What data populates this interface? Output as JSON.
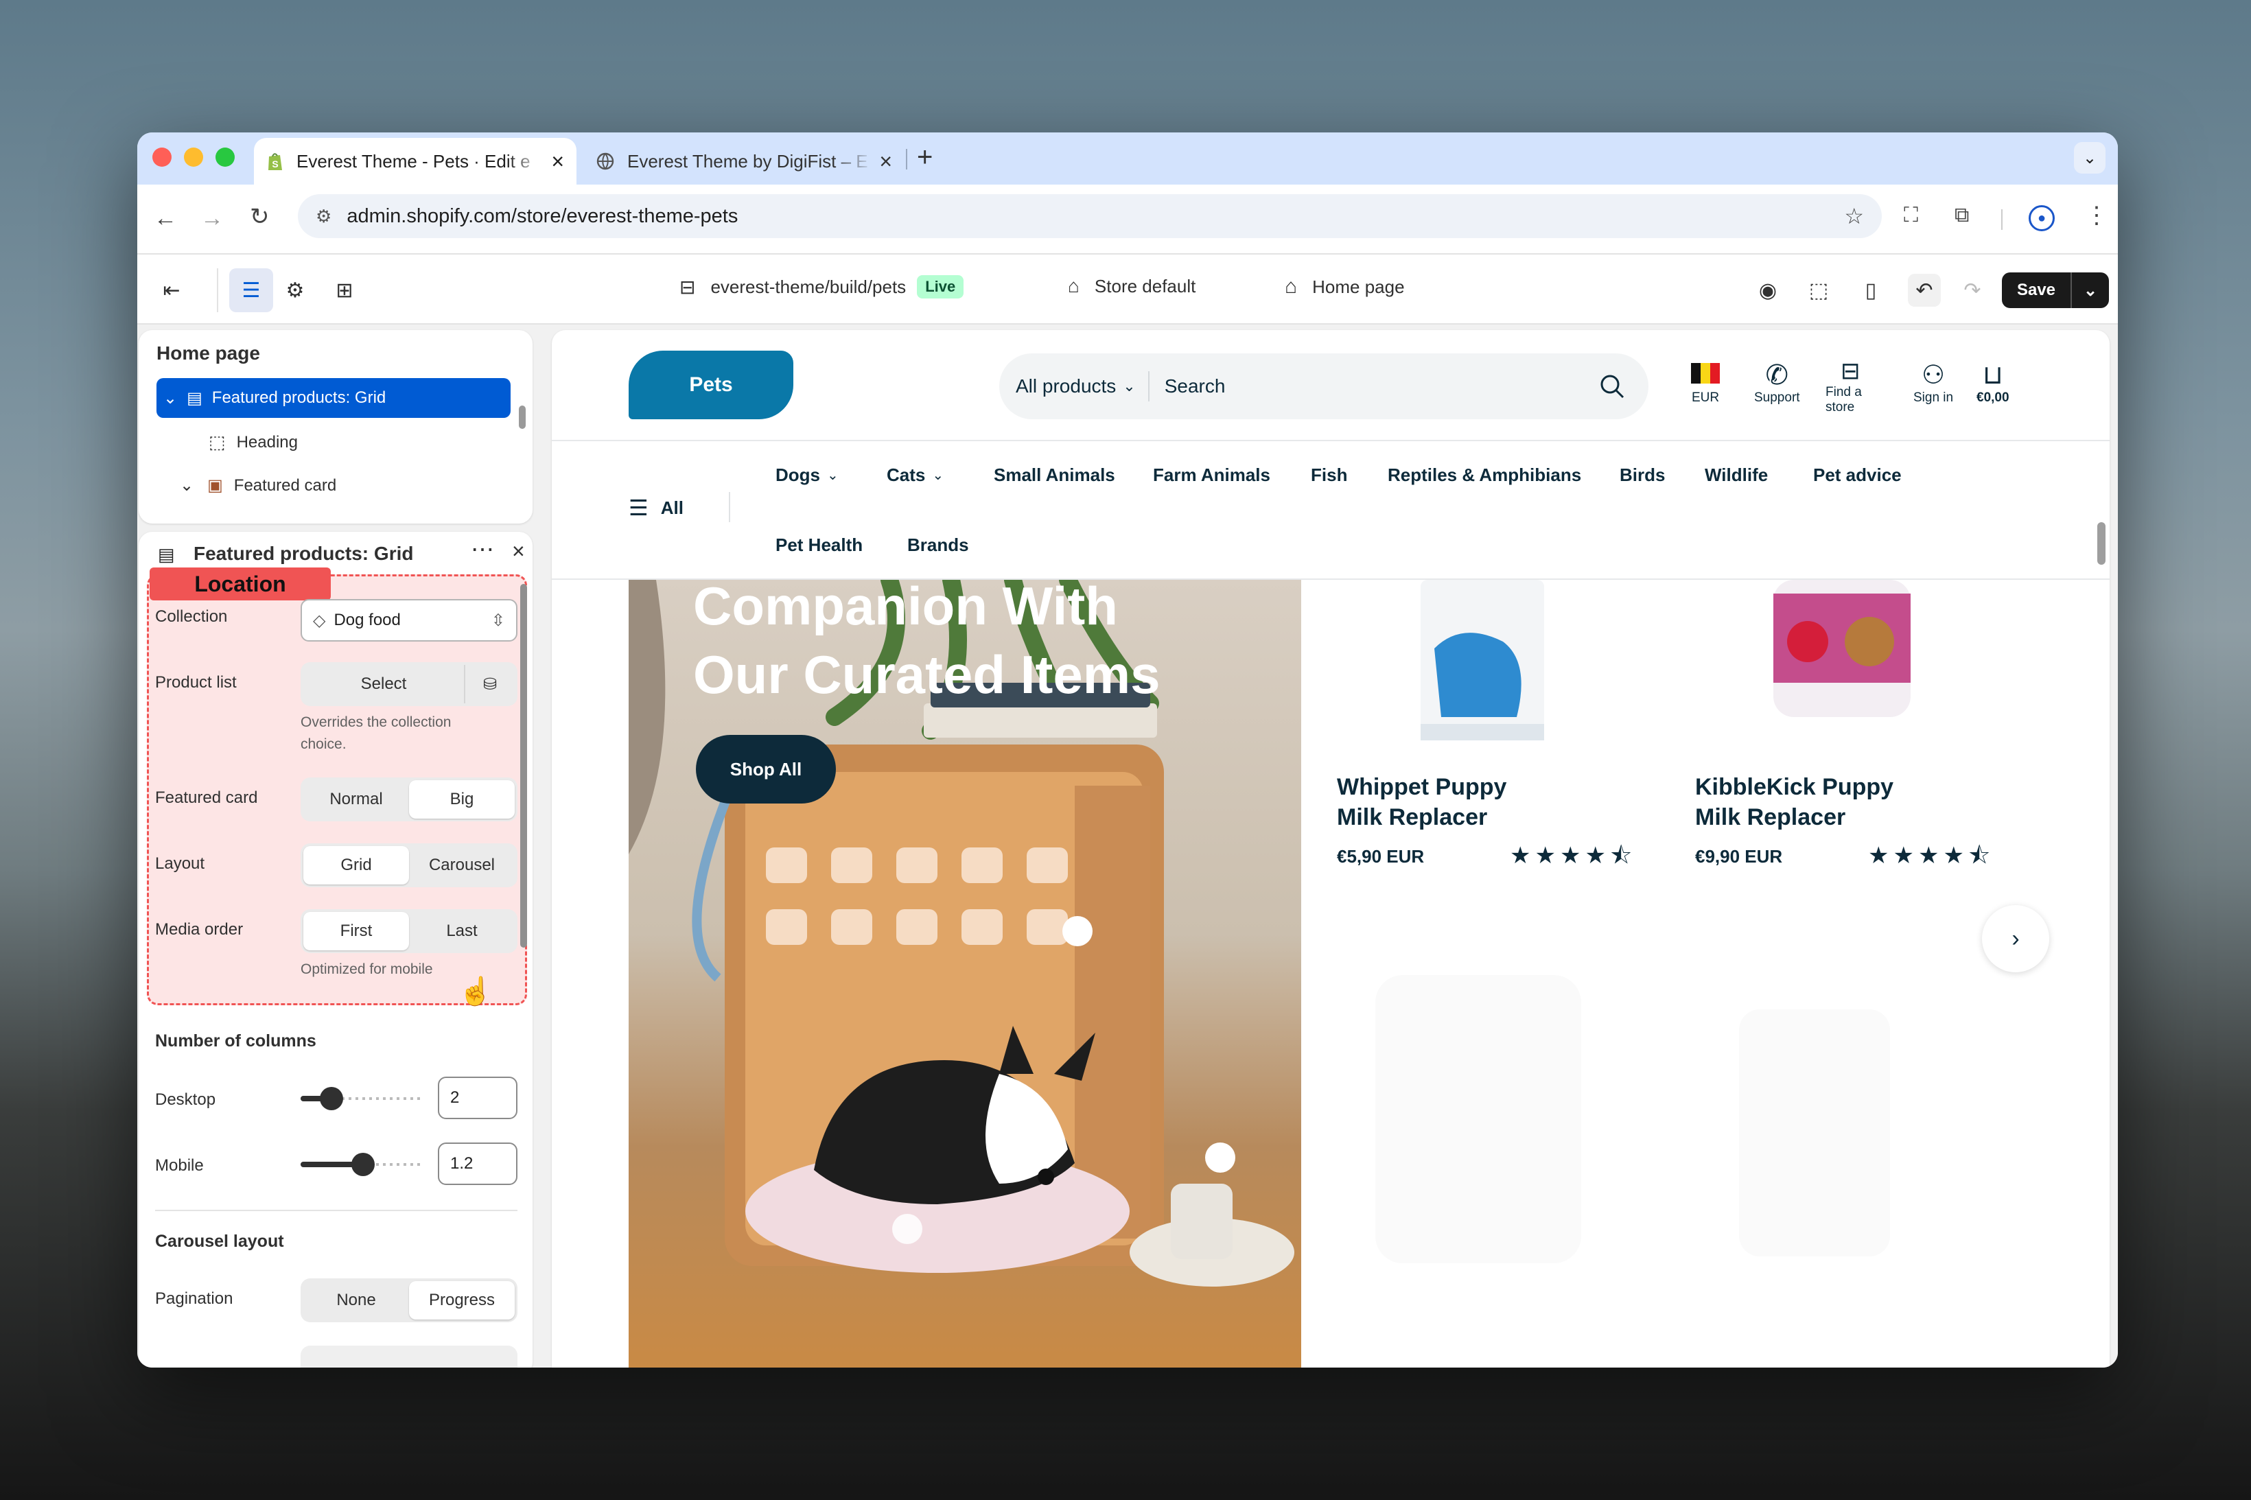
{
  "browser": {
    "tabs": [
      {
        "title": "Everest Theme - Pets · Edit e",
        "icon": "shopify-icon"
      },
      {
        "title": "Everest Theme by DigiFist – E",
        "icon": "globe-icon"
      }
    ],
    "url": "admin.shopify.com/store/everest-theme-pets"
  },
  "editor": {
    "theme_path": "everest-theme/build/pets",
    "live_badge": "Live",
    "store": "Store default",
    "page": "Home page",
    "save": "Save"
  },
  "tree": {
    "title": "Home page",
    "items": [
      {
        "label": "Featured products: Grid",
        "selected": true
      },
      {
        "label": "Heading"
      },
      {
        "label": "Featured card"
      }
    ]
  },
  "settings": {
    "title": "Featured products: Grid",
    "location_tag": "Location",
    "collection_label": "Collection",
    "collection_value": "Dog food",
    "product_list_label": "Product list",
    "select_label": "Select",
    "product_list_help": [
      "Overrides the collection",
      "choice."
    ],
    "featured_card_label": "Featured card",
    "featured_card_options": [
      "Normal",
      "Big"
    ],
    "layout_label": "Layout",
    "layout_options": [
      "Grid",
      "Carousel"
    ],
    "media_order_label": "Media order",
    "media_order_options": [
      "First",
      "Last"
    ],
    "media_order_help": "Optimized for mobile",
    "columns_heading": "Number of columns",
    "desktop_label": "Desktop",
    "desktop_value": "2",
    "mobile_label": "Mobile",
    "mobile_value": "1.2",
    "carousel_heading": "Carousel layout",
    "pagination_label": "Pagination",
    "pagination_options": [
      "None",
      "Progress"
    ]
  },
  "store": {
    "logo": "Pets",
    "search_scope": "All products",
    "search_placeholder": "Search",
    "currency": "EUR",
    "support": "Support",
    "find_store": [
      "Find a",
      "store"
    ],
    "sign_in": "Sign in",
    "cart_total": "€0,00",
    "menu_all": "All",
    "nav_row1": [
      "Dogs",
      "Cats",
      "Small Animals",
      "Farm Animals",
      "Fish",
      "Reptiles & Amphibians",
      "Birds",
      "Wildlife",
      "Pet advice"
    ],
    "nav_row2": [
      "Pet Health",
      "Brands"
    ],
    "hero_title": [
      "Companion With",
      "Our Curated Items"
    ],
    "hero_button": "Shop All",
    "products": [
      {
        "name": [
          "Whippet Puppy",
          "Milk Replacer"
        ],
        "price": "€5,90 EUR",
        "rating": 4.5
      },
      {
        "name": [
          "KibbleKick Puppy",
          "Milk Replacer"
        ],
        "price": "€9,90 EUR",
        "rating": 4.5
      }
    ]
  },
  "colors": {
    "accent_blue": "#0a78a8",
    "navy": "#0d2a3a",
    "selection": "#005bd3",
    "location_red": "#f05454"
  }
}
